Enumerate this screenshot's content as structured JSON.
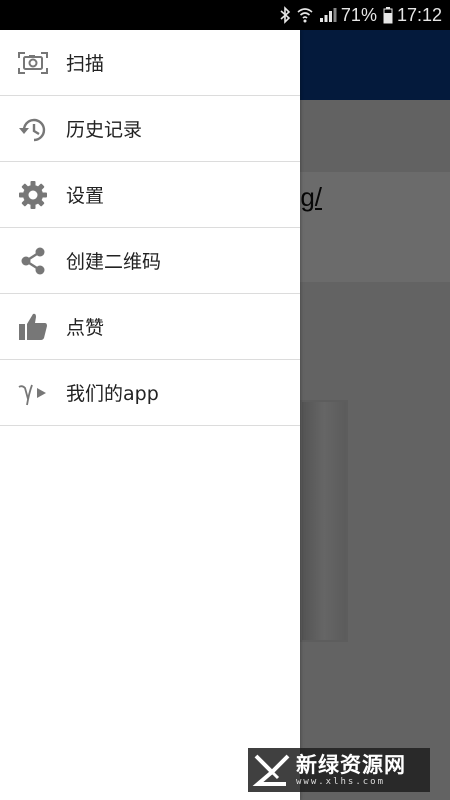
{
  "status_bar": {
    "battery_percent": "71%",
    "time": "17:12",
    "icons": [
      "bluetooth-icon",
      "wifi-icon",
      "signal-icon",
      "battery-icon"
    ]
  },
  "background_app": {
    "visible_text": "g/",
    "appbar_color": "#0b3f8f"
  },
  "drawer": {
    "items": [
      {
        "label": "扫描",
        "icon": "camera-scan-icon"
      },
      {
        "label": "历史记录",
        "icon": "history-icon"
      },
      {
        "label": "设置",
        "icon": "gear-icon"
      },
      {
        "label": "创建二维码",
        "icon": "share-icon"
      },
      {
        "label": "点赞",
        "icon": "thumbs-up-icon"
      },
      {
        "label": "我们的app",
        "icon": "gamma-play-icon"
      }
    ]
  },
  "watermark": {
    "title": "新绿资源网",
    "subtitle": "www.xlhs.com"
  }
}
